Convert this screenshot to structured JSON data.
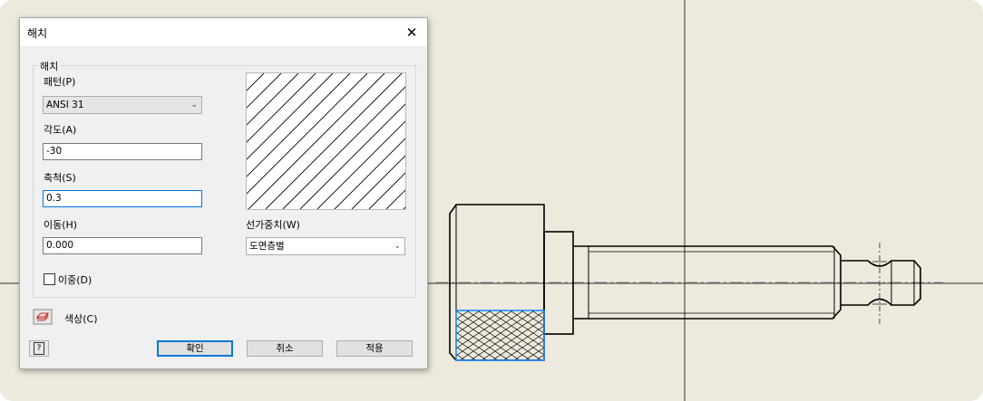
{
  "dialog": {
    "title": "해치",
    "close_glyph": "✕",
    "group_label": "해치",
    "pattern": {
      "label": "패턴(P)",
      "value": "ANSI 31"
    },
    "angle": {
      "label": "각도(A)",
      "value": "-30"
    },
    "scale": {
      "label": "축척(S)",
      "value": "0.3"
    },
    "offset": {
      "label": "이동(H)",
      "value": "0.000"
    },
    "lineweight": {
      "label": "선가중치(W)",
      "value": "도면층별"
    },
    "double": {
      "label": "이중(D)",
      "checked": false
    },
    "color": {
      "label": "색상(C)"
    },
    "help_glyph": "?",
    "buttons": {
      "ok": "확인",
      "cancel": "취소",
      "apply": "적용"
    }
  },
  "icons": {
    "close": "close-icon",
    "dropdown": "chevron-down-icon",
    "help": "help-icon",
    "color": "layers-color-icon"
  },
  "colors": {
    "background": "#ede9dc",
    "selection": "#0078d7",
    "line": "#000000"
  }
}
